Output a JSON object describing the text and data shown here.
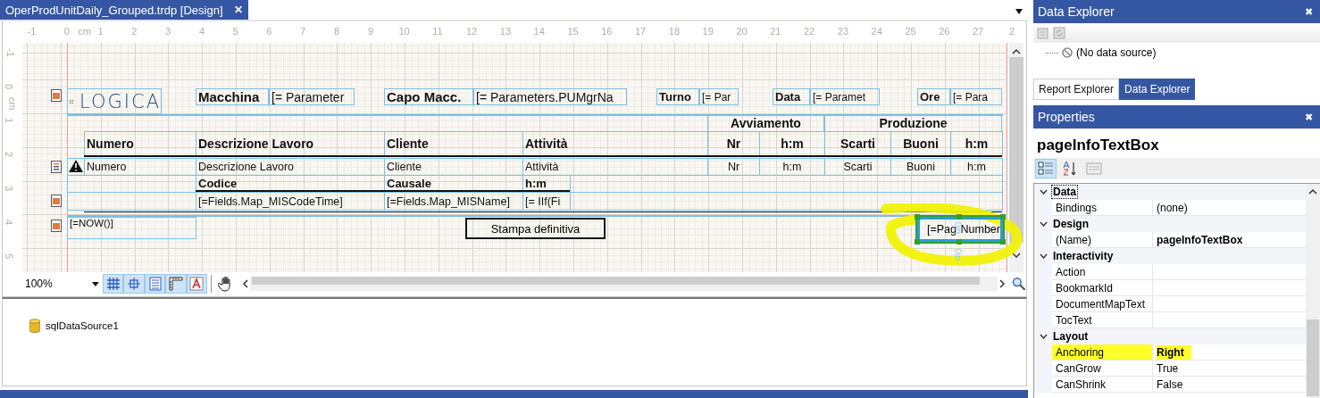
{
  "document_tab": {
    "title": "OperProdUnitDaily_Grouped.trdp [Design]",
    "close": "✕",
    "selected": true
  },
  "designer": {
    "rulers": {
      "horizontal": [
        "-1",
        "0",
        "cm",
        "1",
        "2",
        "3",
        "4",
        "5",
        "6",
        "7",
        "8",
        "9",
        "10",
        "11",
        "12",
        "13",
        "14",
        "15",
        "16",
        "17",
        "18",
        "19",
        "20",
        "21",
        "22",
        "23",
        "24",
        "25",
        "26",
        "27",
        "2"
      ],
      "vertical": [
        "-1",
        "0",
        "cm",
        "1",
        "2",
        "3",
        "4",
        "5"
      ]
    },
    "report": {
      "page_header": {
        "logo": "LOGICA",
        "fields": [
          {
            "label": "Macchina",
            "value": "[= Parameter"
          },
          {
            "label": "Capo Macc.",
            "value": "[= Parameters.PUMgrNa"
          },
          {
            "label": "Turno",
            "value": "[= Par"
          },
          {
            "label": "Data",
            "value": "[= Paramet"
          },
          {
            "label": "Ore",
            "value": "[= Para"
          }
        ]
      },
      "column_groups": [
        "Avviamento",
        "Produzione"
      ],
      "column_headers": [
        "Numero",
        "Descrizione Lavoro",
        "Cliente",
        "Attività",
        "Nr",
        "h:m",
        "Scarti",
        "Buoni",
        "h:m"
      ],
      "detail_cells": [
        "Numero",
        "Descrizione Lavoro",
        "Cliente",
        "Attività",
        "Nr",
        "h:m",
        "Scarti",
        "Buoni",
        "h:m"
      ],
      "group_footer_headers": [
        "Codice",
        "Causale",
        "h:m"
      ],
      "group_footer_cells": [
        "[=Fields.Map_MISCodeTime]",
        "[=Fields.Map_MISName]",
        "[= IIf(Fi"
      ],
      "page_footer": {
        "timestamp": "[=NOW()]",
        "status": "Stampa definitiva",
        "page_number": {
          "text_start": "[=Pag",
          "text_end": "Number",
          "selected": true,
          "highlighted": true,
          "margin_hints": [
            "0in",
            "0in"
          ]
        }
      }
    },
    "toolbar": {
      "zoom": "100%",
      "toggles": [
        {
          "kind": "grid",
          "selected": true
        },
        {
          "kind": "snap",
          "selected": true
        },
        {
          "kind": "bands",
          "selected": true
        },
        {
          "kind": "rulers",
          "selected": true
        },
        {
          "kind": "text",
          "selected": true
        }
      ],
      "pan": {
        "selected": false
      }
    }
  },
  "component_tray": {
    "items": [
      "sqlDataSource1"
    ]
  },
  "data_explorer": {
    "title": "Data Explorer",
    "close": "✖",
    "tree": [
      "(No data source)"
    ]
  },
  "explorer_tabs": [
    {
      "label": "Report Explorer",
      "selected": false
    },
    {
      "label": "Data Explorer",
      "selected": true
    }
  ],
  "properties": {
    "title": "Properties",
    "close": "✖",
    "object_name": "pageInfoTextBox",
    "view_modes": [
      {
        "kind": "categorized",
        "selected": true
      },
      {
        "kind": "alphabetical",
        "selected": false
      },
      {
        "kind": "pages",
        "selected": false
      }
    ],
    "categories": [
      {
        "name": "Data",
        "expanded": true,
        "focused": true,
        "properties": [
          {
            "name": "Bindings",
            "value": "(none)",
            "modified": false,
            "highlighted": false
          }
        ]
      },
      {
        "name": "Design",
        "expanded": true,
        "focused": false,
        "properties": [
          {
            "name": "(Name)",
            "value": "pageInfoTextBox",
            "modified": true,
            "highlighted": false
          }
        ]
      },
      {
        "name": "Interactivity",
        "expanded": true,
        "focused": false,
        "properties": [
          {
            "name": "Action",
            "modified": false,
            "highlighted": false
          },
          {
            "name": "BookmarkId",
            "modified": false,
            "highlighted": false
          },
          {
            "name": "DocumentMapText",
            "modified": false,
            "highlighted": false
          },
          {
            "name": "TocText",
            "modified": false,
            "highlighted": false
          }
        ]
      },
      {
        "name": "Layout",
        "expanded": true,
        "focused": false,
        "properties": [
          {
            "name": "Anchoring",
            "value": "Right",
            "modified": true,
            "highlighted": true
          },
          {
            "name": "CanGrow",
            "value": "True",
            "modified": false,
            "highlighted": false
          },
          {
            "name": "CanShrink",
            "value": "False",
            "modified": false,
            "highlighted": false
          }
        ]
      }
    ]
  }
}
